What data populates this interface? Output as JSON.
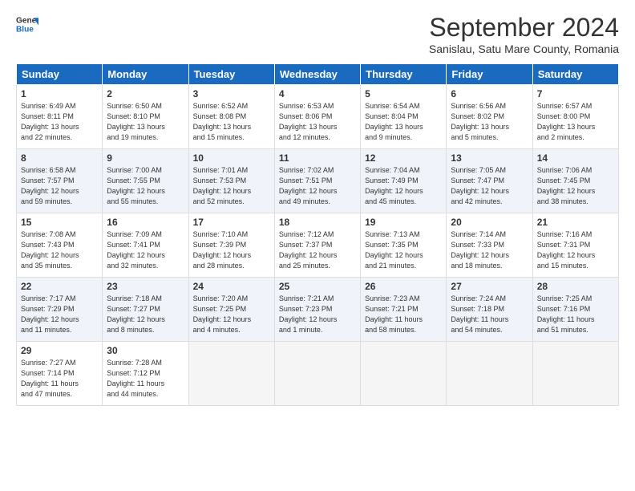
{
  "logo": {
    "line1": "General",
    "line2": "Blue"
  },
  "title": "September 2024",
  "subtitle": "Sanislau, Satu Mare County, Romania",
  "days_of_week": [
    "Sunday",
    "Monday",
    "Tuesday",
    "Wednesday",
    "Thursday",
    "Friday",
    "Saturday"
  ],
  "weeks": [
    [
      {
        "num": "1",
        "info": "Sunrise: 6:49 AM\nSunset: 8:11 PM\nDaylight: 13 hours\nand 22 minutes."
      },
      {
        "num": "2",
        "info": "Sunrise: 6:50 AM\nSunset: 8:10 PM\nDaylight: 13 hours\nand 19 minutes."
      },
      {
        "num": "3",
        "info": "Sunrise: 6:52 AM\nSunset: 8:08 PM\nDaylight: 13 hours\nand 15 minutes."
      },
      {
        "num": "4",
        "info": "Sunrise: 6:53 AM\nSunset: 8:06 PM\nDaylight: 13 hours\nand 12 minutes."
      },
      {
        "num": "5",
        "info": "Sunrise: 6:54 AM\nSunset: 8:04 PM\nDaylight: 13 hours\nand 9 minutes."
      },
      {
        "num": "6",
        "info": "Sunrise: 6:56 AM\nSunset: 8:02 PM\nDaylight: 13 hours\nand 5 minutes."
      },
      {
        "num": "7",
        "info": "Sunrise: 6:57 AM\nSunset: 8:00 PM\nDaylight: 13 hours\nand 2 minutes."
      }
    ],
    [
      {
        "num": "8",
        "info": "Sunrise: 6:58 AM\nSunset: 7:57 PM\nDaylight: 12 hours\nand 59 minutes."
      },
      {
        "num": "9",
        "info": "Sunrise: 7:00 AM\nSunset: 7:55 PM\nDaylight: 12 hours\nand 55 minutes."
      },
      {
        "num": "10",
        "info": "Sunrise: 7:01 AM\nSunset: 7:53 PM\nDaylight: 12 hours\nand 52 minutes."
      },
      {
        "num": "11",
        "info": "Sunrise: 7:02 AM\nSunset: 7:51 PM\nDaylight: 12 hours\nand 49 minutes."
      },
      {
        "num": "12",
        "info": "Sunrise: 7:04 AM\nSunset: 7:49 PM\nDaylight: 12 hours\nand 45 minutes."
      },
      {
        "num": "13",
        "info": "Sunrise: 7:05 AM\nSunset: 7:47 PM\nDaylight: 12 hours\nand 42 minutes."
      },
      {
        "num": "14",
        "info": "Sunrise: 7:06 AM\nSunset: 7:45 PM\nDaylight: 12 hours\nand 38 minutes."
      }
    ],
    [
      {
        "num": "15",
        "info": "Sunrise: 7:08 AM\nSunset: 7:43 PM\nDaylight: 12 hours\nand 35 minutes."
      },
      {
        "num": "16",
        "info": "Sunrise: 7:09 AM\nSunset: 7:41 PM\nDaylight: 12 hours\nand 32 minutes."
      },
      {
        "num": "17",
        "info": "Sunrise: 7:10 AM\nSunset: 7:39 PM\nDaylight: 12 hours\nand 28 minutes."
      },
      {
        "num": "18",
        "info": "Sunrise: 7:12 AM\nSunset: 7:37 PM\nDaylight: 12 hours\nand 25 minutes."
      },
      {
        "num": "19",
        "info": "Sunrise: 7:13 AM\nSunset: 7:35 PM\nDaylight: 12 hours\nand 21 minutes."
      },
      {
        "num": "20",
        "info": "Sunrise: 7:14 AM\nSunset: 7:33 PM\nDaylight: 12 hours\nand 18 minutes."
      },
      {
        "num": "21",
        "info": "Sunrise: 7:16 AM\nSunset: 7:31 PM\nDaylight: 12 hours\nand 15 minutes."
      }
    ],
    [
      {
        "num": "22",
        "info": "Sunrise: 7:17 AM\nSunset: 7:29 PM\nDaylight: 12 hours\nand 11 minutes."
      },
      {
        "num": "23",
        "info": "Sunrise: 7:18 AM\nSunset: 7:27 PM\nDaylight: 12 hours\nand 8 minutes."
      },
      {
        "num": "24",
        "info": "Sunrise: 7:20 AM\nSunset: 7:25 PM\nDaylight: 12 hours\nand 4 minutes."
      },
      {
        "num": "25",
        "info": "Sunrise: 7:21 AM\nSunset: 7:23 PM\nDaylight: 12 hours\nand 1 minute."
      },
      {
        "num": "26",
        "info": "Sunrise: 7:23 AM\nSunset: 7:21 PM\nDaylight: 11 hours\nand 58 minutes."
      },
      {
        "num": "27",
        "info": "Sunrise: 7:24 AM\nSunset: 7:18 PM\nDaylight: 11 hours\nand 54 minutes."
      },
      {
        "num": "28",
        "info": "Sunrise: 7:25 AM\nSunset: 7:16 PM\nDaylight: 11 hours\nand 51 minutes."
      }
    ],
    [
      {
        "num": "29",
        "info": "Sunrise: 7:27 AM\nSunset: 7:14 PM\nDaylight: 11 hours\nand 47 minutes."
      },
      {
        "num": "30",
        "info": "Sunrise: 7:28 AM\nSunset: 7:12 PM\nDaylight: 11 hours\nand 44 minutes."
      },
      {
        "num": "",
        "info": ""
      },
      {
        "num": "",
        "info": ""
      },
      {
        "num": "",
        "info": ""
      },
      {
        "num": "",
        "info": ""
      },
      {
        "num": "",
        "info": ""
      }
    ]
  ]
}
